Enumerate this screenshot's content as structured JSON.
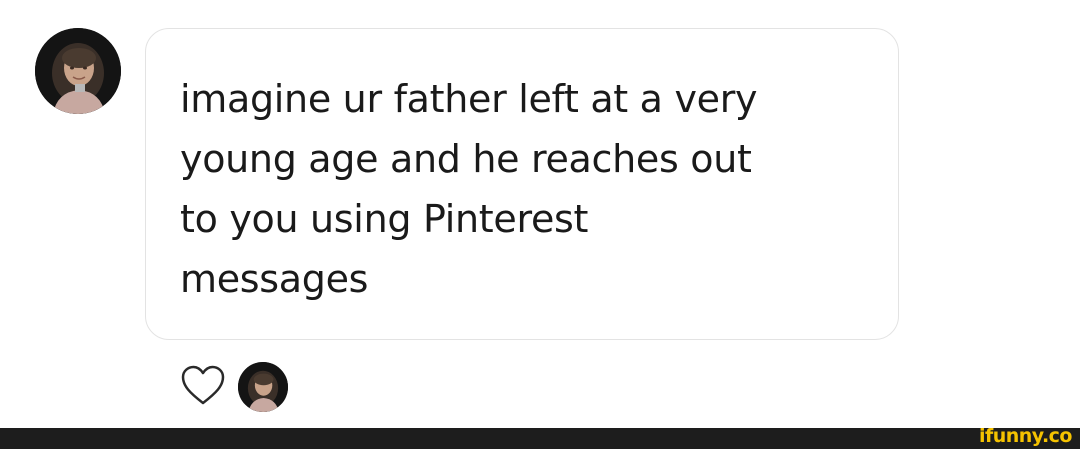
{
  "comment": {
    "text": "imagine ur father left at a very\nyoung age and he reaches out\nto you using Pinterest\nmessages"
  },
  "icons": {
    "like": "heart-outline-icon",
    "author_avatar": "avatar",
    "liker_avatar": "avatar"
  },
  "watermark": {
    "text": "ifunny.co"
  },
  "colors": {
    "text": "#1a1a1a",
    "bubble_border": "#e3e3e3",
    "footer": "#1d1d1d",
    "watermark": "#f5c200"
  }
}
